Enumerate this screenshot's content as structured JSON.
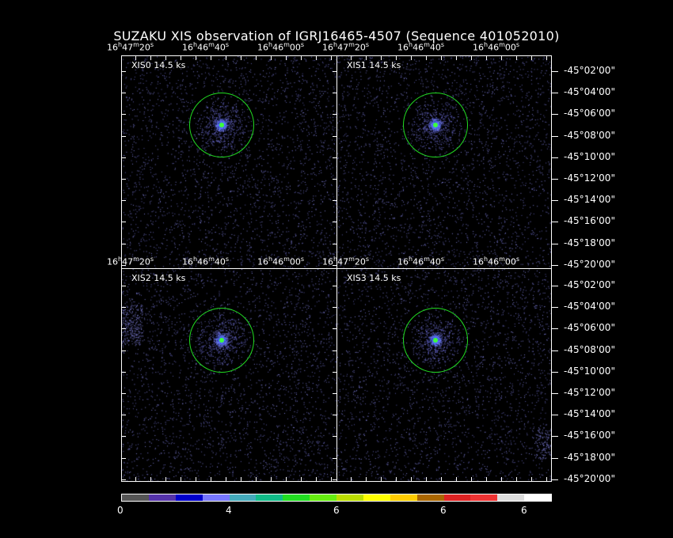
{
  "title": "SUZAKU XIS observation of IGRJ16465-4507  (Sequence 401052010)",
  "panels": [
    {
      "label": "XIS0 14.5 ks"
    },
    {
      "label": "XIS1 14.5 ks"
    },
    {
      "label": "XIS2 14.5 ks"
    },
    {
      "label": "XIS3 14.5 ks"
    }
  ],
  "ra_labels": [
    "16h47m20s",
    "16h46m40s",
    "16h46m00s"
  ],
  "dec_labels": [
    "-45°02'00\"",
    "-45°04'00\"",
    "-45°06'00\"",
    "-45°08'00\"",
    "-45°10'00\"",
    "-45°12'00\"",
    "-45°14'00\"",
    "-45°16'00\"",
    "-45°18'00\"",
    "-45°20'00\""
  ],
  "colorbar": {
    "colors": [
      "#555555",
      "#5533aa",
      "#0000cc",
      "#7777ff",
      "#44aabb",
      "#11bb88",
      "#22dd22",
      "#66ee11",
      "#bbdd00",
      "#ffff00",
      "#ffcc00",
      "#aa6600",
      "#dd2222",
      "#ee3333",
      "#dddddd",
      "#ffffff"
    ],
    "labels": [
      "0",
      "4",
      "6",
      "6",
      "6"
    ]
  },
  "colors": {
    "region": "#22dd22",
    "events": "#6a6acc",
    "frame": "#ffffff"
  }
}
